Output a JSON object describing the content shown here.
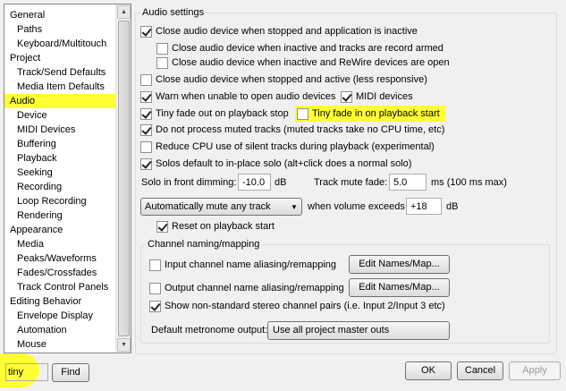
{
  "tree": {
    "items": [
      {
        "label": "General",
        "level": 0
      },
      {
        "label": "Paths",
        "level": 1
      },
      {
        "label": "Keyboard/Multitouch",
        "level": 1
      },
      {
        "label": "Project",
        "level": 0
      },
      {
        "label": "Track/Send Defaults",
        "level": 1
      },
      {
        "label": "Media Item Defaults",
        "level": 1
      },
      {
        "label": "Audio",
        "level": 0,
        "selected": true
      },
      {
        "label": "Device",
        "level": 1
      },
      {
        "label": "MIDI Devices",
        "level": 1
      },
      {
        "label": "Buffering",
        "level": 1
      },
      {
        "label": "Playback",
        "level": 1
      },
      {
        "label": "Seeking",
        "level": 1
      },
      {
        "label": "Recording",
        "level": 1
      },
      {
        "label": "Loop Recording",
        "level": 1
      },
      {
        "label": "Rendering",
        "level": 1
      },
      {
        "label": "Appearance",
        "level": 0
      },
      {
        "label": "Media",
        "level": 1
      },
      {
        "label": "Peaks/Waveforms",
        "level": 1
      },
      {
        "label": "Fades/Crossfades",
        "level": 1
      },
      {
        "label": "Track Control Panels",
        "level": 1
      },
      {
        "label": "Editing Behavior",
        "level": 0
      },
      {
        "label": "Envelope Display",
        "level": 1
      },
      {
        "label": "Automation",
        "level": 1
      },
      {
        "label": "Mouse",
        "level": 1
      }
    ],
    "scroll_up_icon": "triangle-up",
    "scroll_down_icon": "triangle-down"
  },
  "search": {
    "value": "tiny",
    "find_label": "Find"
  },
  "buttons": {
    "ok": "OK",
    "cancel": "Cancel",
    "apply": "Apply"
  },
  "audio": {
    "title": "Audio settings",
    "close_device": {
      "label": "Close audio device when stopped and application is inactive",
      "checked": true
    },
    "close_inactive_record": {
      "label": "Close audio device when inactive and tracks are record armed",
      "checked": false
    },
    "close_inactive_rewire": {
      "label": "Close audio device when inactive and ReWire devices are open",
      "checked": false
    },
    "close_stopped_active": {
      "label": "Close audio device when stopped and active (less responsive)",
      "checked": false
    },
    "warn_unable": {
      "label": "Warn when unable to open audio devices",
      "checked": true
    },
    "midi_devices": {
      "label": "MIDI devices",
      "checked": true
    },
    "tiny_fade_out": {
      "label": "Tiny fade out on playback stop",
      "checked": true
    },
    "tiny_fade_in": {
      "label": "Tiny fade in on playback start",
      "checked": false
    },
    "no_process_muted": {
      "label": "Do not process muted tracks (muted tracks take no CPU time, etc)",
      "checked": true
    },
    "reduce_cpu": {
      "label": "Reduce CPU use of silent tracks during playback (experimental)",
      "checked": false
    },
    "solos_inplace": {
      "label": "Solos default to in-place solo (alt+click does a normal solo)",
      "checked": true
    },
    "solo_dim_label": "Solo in front dimming:",
    "solo_dim_value": "-10.0",
    "solo_dim_unit": "dB",
    "track_mute_fade_label": "Track mute fade:",
    "track_mute_fade_value": "5.0",
    "track_mute_fade_unit": "ms (100 ms max)",
    "auto_mute_select": "Automatically mute any track",
    "volume_exceeds_label": "when volume exceeds",
    "volume_exceeds_value": "+18",
    "volume_exceeds_unit": "dB",
    "reset_playback": {
      "label": "Reset on playback start",
      "checked": true
    }
  },
  "channel": {
    "title": "Channel naming/mapping",
    "input_alias": {
      "label": "Input channel name aliasing/remapping",
      "checked": false
    },
    "output_alias": {
      "label": "Output channel name aliasing/remapping",
      "checked": false
    },
    "edit_names_label": "Edit Names/Map...",
    "show_nonstandard": {
      "label": "Show non-standard stereo channel pairs (i.e. Input 2/Input 3 etc)",
      "checked": true
    },
    "metronome_label": "Default metronome output:",
    "metronome_value": "Use all project master outs"
  },
  "colors": {
    "highlight": "#ffff33",
    "panel_bg": "#f0f0f0"
  }
}
